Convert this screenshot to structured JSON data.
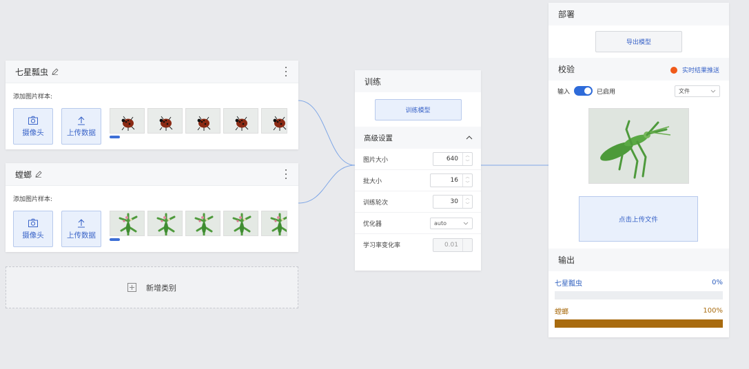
{
  "classes": [
    {
      "title": "七星瓢虫",
      "sample_label": "添加图片样本:",
      "camera_label": "摄像头",
      "upload_label": "上传数据",
      "thumb_kind": "ladybug"
    },
    {
      "title": "螳螂",
      "sample_label": "添加图片样本:",
      "camera_label": "摄像头",
      "upload_label": "上传数据",
      "thumb_kind": "mantis"
    }
  ],
  "add_class_label": "新增类别",
  "training": {
    "title": "训练",
    "train_button": "训练模型",
    "advanced_title": "高级设置",
    "params": [
      {
        "label": "图片大小",
        "value": "640"
      },
      {
        "label": "批大小",
        "value": "16"
      },
      {
        "label": "训练轮次",
        "value": "30"
      },
      {
        "label": "优化器",
        "value": "auto"
      },
      {
        "label": "学习率变化率",
        "value": "0.01"
      }
    ]
  },
  "deploy": {
    "title": "部署",
    "export_button": "导出模型"
  },
  "validate": {
    "title": "校验",
    "push_label": "实时结果推送",
    "input_label": "输入",
    "enabled_label": "已启用",
    "source_select": "文件",
    "upload_button": "点击上传文件"
  },
  "output": {
    "title": "输出",
    "results": [
      {
        "label": "七星瓢虫",
        "percent_label": "0%",
        "fraction": 0.0,
        "color": "#2e5fbf"
      },
      {
        "label": "螳螂",
        "percent_label": "100%",
        "fraction": 1.0,
        "color": "#a86b0f"
      }
    ]
  },
  "colors": {
    "accent": "#3a64c8",
    "toggle": "#2e6bd9",
    "push_dot": "#f05a1a",
    "mantis_bar": "#a86b0f"
  }
}
